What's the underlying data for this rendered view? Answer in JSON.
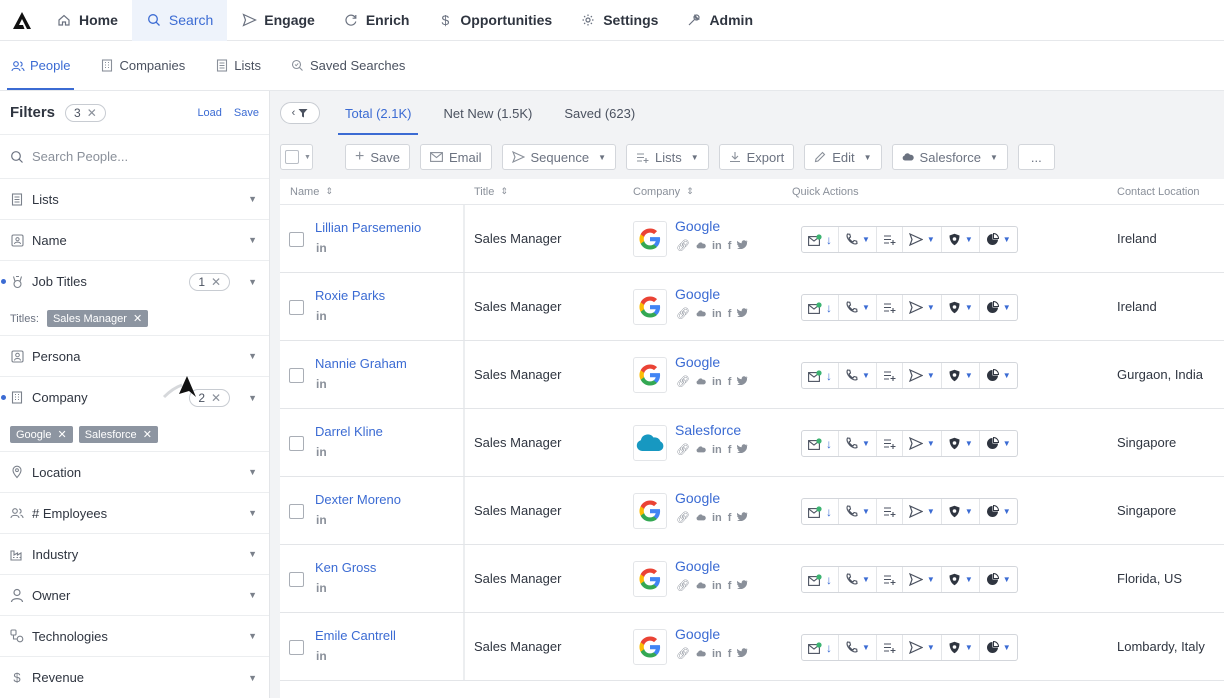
{
  "topnav": {
    "items": [
      {
        "label": "Home",
        "icon": "home-icon"
      },
      {
        "label": "Search",
        "icon": "search-icon",
        "active": true
      },
      {
        "label": "Engage",
        "icon": "send-icon"
      },
      {
        "label": "Enrich",
        "icon": "refresh-icon"
      },
      {
        "label": "Opportunities",
        "icon": "dollar-icon"
      },
      {
        "label": "Settings",
        "icon": "gear-icon"
      },
      {
        "label": "Admin",
        "icon": "wrench-icon"
      }
    ]
  },
  "subnav": {
    "items": [
      {
        "label": "People",
        "icon": "people-icon",
        "active": true
      },
      {
        "label": "Companies",
        "icon": "building-icon"
      },
      {
        "label": "Lists",
        "icon": "list-icon"
      },
      {
        "label": "Saved Searches",
        "icon": "search-icon"
      }
    ]
  },
  "sidebar": {
    "title": "Filters",
    "count": "3",
    "load_label": "Load",
    "save_label": "Save",
    "search_placeholder": "Search People...",
    "filters": [
      {
        "label": "Lists",
        "icon": "list-icon"
      },
      {
        "label": "Name",
        "icon": "id-card-icon"
      },
      {
        "label": "Job Titles",
        "icon": "badge-icon",
        "count": "1",
        "active": true
      },
      {
        "label": "Persona",
        "icon": "persona-icon"
      },
      {
        "label": "Company",
        "icon": "building-icon",
        "count": "2",
        "active": true
      },
      {
        "label": "Location",
        "icon": "location-pin-icon"
      },
      {
        "label": "# Employees",
        "icon": "people-icon"
      },
      {
        "label": "Industry",
        "icon": "factory-icon"
      },
      {
        "label": "Owner",
        "icon": "user-icon"
      },
      {
        "label": "Technologies",
        "icon": "technologies-icon"
      },
      {
        "label": "Revenue",
        "icon": "dollar-icon"
      }
    ],
    "titles_label": "Titles:",
    "title_chips": [
      "Sales Manager"
    ],
    "company_chips": [
      "Google",
      "Salesforce"
    ]
  },
  "tabs": [
    {
      "label": "Total (2.1K)",
      "active": true
    },
    {
      "label": "Net New (1.5K)"
    },
    {
      "label": "Saved (623)"
    }
  ],
  "toolbar": {
    "save": "Save",
    "email": "Email",
    "sequence": "Sequence",
    "lists": "Lists",
    "export": "Export",
    "edit": "Edit",
    "salesforce": "Salesforce",
    "more": "..."
  },
  "table": {
    "headers": {
      "name": "Name",
      "title": "Title",
      "company": "Company",
      "quick_actions": "Quick Actions",
      "location": "Contact Location"
    },
    "rows": [
      {
        "name": "Lillian Parsemenio",
        "title": "Sales Manager",
        "company": "Google",
        "logo": "google",
        "location": "Ireland"
      },
      {
        "name": "Roxie Parks",
        "title": "Sales Manager",
        "company": "Google",
        "logo": "google",
        "location": "Ireland"
      },
      {
        "name": "Nannie Graham",
        "title": "Sales Manager",
        "company": "Google",
        "logo": "google",
        "location": "Gurgaon, India"
      },
      {
        "name": "Darrel Kline",
        "title": "Sales Manager",
        "company": "Salesforce",
        "logo": "salesforce",
        "location": "Singapore"
      },
      {
        "name": "Dexter Moreno",
        "title": "Sales Manager",
        "company": "Google",
        "logo": "google",
        "location": "Singapore"
      },
      {
        "name": "Ken Gross",
        "title": "Sales Manager",
        "company": "Google",
        "logo": "google",
        "location": "Florida, US"
      },
      {
        "name": "Emile Cantrell",
        "title": "Sales Manager",
        "company": "Google",
        "logo": "google",
        "location": "Lombardy, Italy"
      }
    ]
  },
  "colors": {
    "accent": "#3b6bd3",
    "chip": "#8d95a1",
    "google_blue": "#4285F4",
    "google_red": "#EA4335",
    "google_yellow": "#FBBC05",
    "google_green": "#34A853",
    "salesforce": "#1798c1"
  }
}
